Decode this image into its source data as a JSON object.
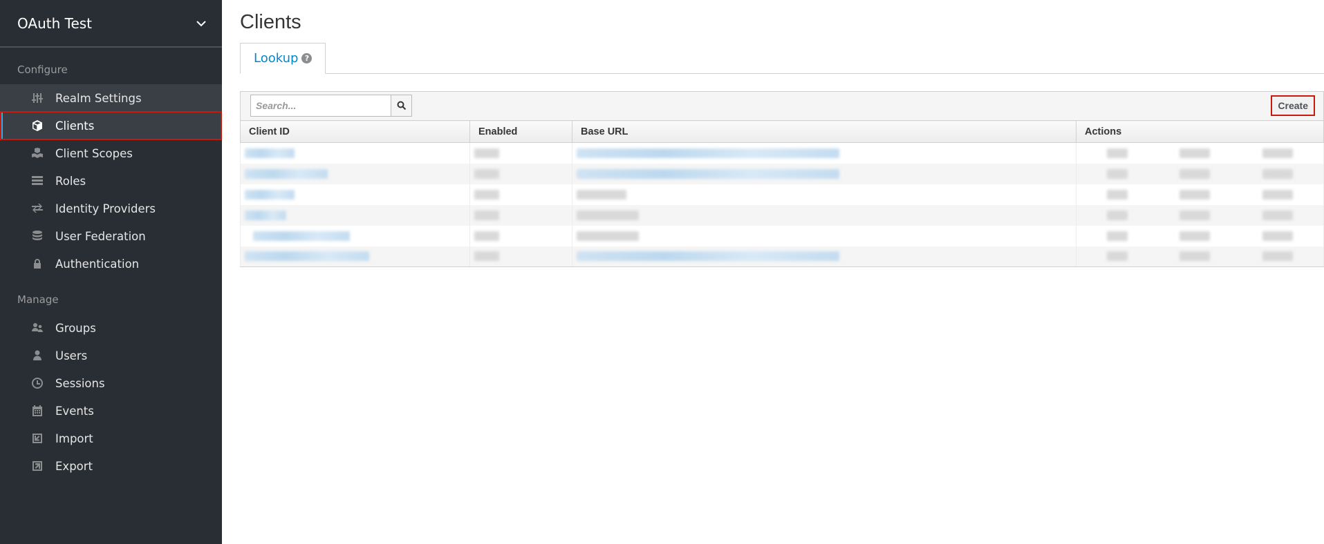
{
  "realm": {
    "name": "OAuth Test"
  },
  "sidebar": {
    "configure_title": "Configure",
    "configure_items": [
      {
        "label": "Realm Settings",
        "icon": "sliders-icon"
      },
      {
        "label": "Clients",
        "icon": "cube-icon"
      },
      {
        "label": "Client Scopes",
        "icon": "cubes-icon"
      },
      {
        "label": "Roles",
        "icon": "list-icon"
      },
      {
        "label": "Identity Providers",
        "icon": "exchange-icon"
      },
      {
        "label": "User Federation",
        "icon": "database-icon"
      },
      {
        "label": "Authentication",
        "icon": "lock-icon"
      }
    ],
    "manage_title": "Manage",
    "manage_items": [
      {
        "label": "Groups",
        "icon": "users-icon"
      },
      {
        "label": "Users",
        "icon": "user-icon"
      },
      {
        "label": "Sessions",
        "icon": "clock-icon"
      },
      {
        "label": "Events",
        "icon": "calendar-icon"
      },
      {
        "label": "Import",
        "icon": "import-icon"
      },
      {
        "label": "Export",
        "icon": "export-icon"
      }
    ]
  },
  "page": {
    "title": "Clients"
  },
  "tabs": [
    {
      "label": "Lookup"
    }
  ],
  "toolbar": {
    "search_placeholder": "Search...",
    "create_label": "Create"
  },
  "table": {
    "columns": [
      "Client ID",
      "Enabled",
      "Base URL",
      "Actions"
    ],
    "rows_count_note": "6 rows with blurred content"
  },
  "colors": {
    "accent": "#39a5dc",
    "link": "#0088ce",
    "highlight": "#c9190b",
    "sidebar_bg": "#292e34"
  }
}
